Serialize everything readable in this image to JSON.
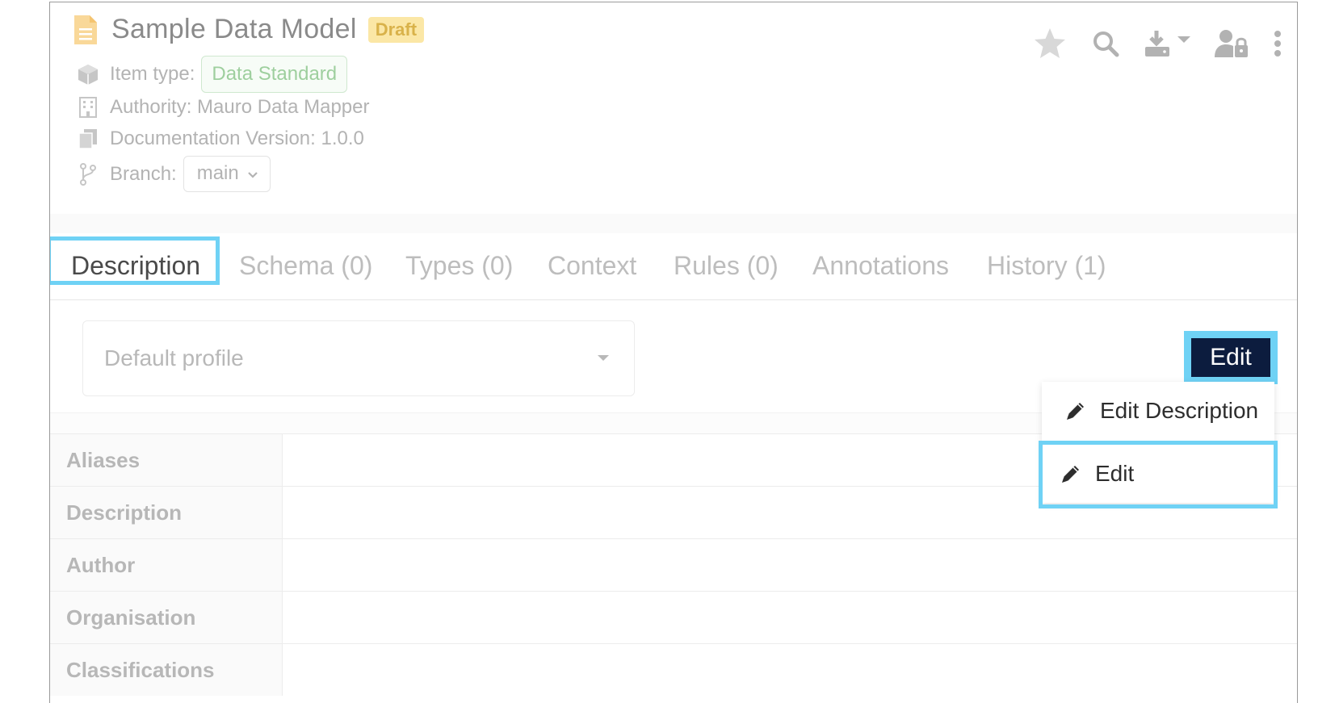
{
  "header": {
    "title": "Sample Data Model",
    "status_badge": "Draft",
    "item_type_label": "Item type:",
    "item_type_value": "Data Standard",
    "authority": "Authority: Mauro Data Mapper",
    "documentation_version": "Documentation Version: 1.0.0",
    "branch_label": "Branch:",
    "branch_value": "main",
    "toolbar_icons": [
      "star-icon",
      "search-icon",
      "download-icon",
      "user-lock-icon",
      "more-vertical-icon"
    ]
  },
  "tabs": [
    {
      "label": "Description",
      "active": true
    },
    {
      "label": "Schema (0)",
      "active": false
    },
    {
      "label": "Types (0)",
      "active": false
    },
    {
      "label": "Context",
      "active": false
    },
    {
      "label": "Rules (0)",
      "active": false
    },
    {
      "label": "Annotations",
      "active": false
    },
    {
      "label": "History (1)",
      "active": false
    }
  ],
  "profile": {
    "selected": "Default profile"
  },
  "edit_button": {
    "label": "Edit"
  },
  "edit_menu": {
    "items": [
      {
        "label": "Edit Description",
        "icon": "pencil-icon"
      },
      {
        "label": "Edit",
        "icon": "pencil-icon"
      }
    ]
  },
  "properties": [
    {
      "key": "Aliases"
    },
    {
      "key": "Description"
    },
    {
      "key": "Author"
    },
    {
      "key": "Organisation"
    },
    {
      "key": "Classifications"
    }
  ],
  "colors": {
    "highlight": "#6fd2f5",
    "edit_button_bg": "#0c1c3e",
    "draft_badge_bg": "#fbe7a6",
    "muted_text": "#b3b3b3"
  }
}
